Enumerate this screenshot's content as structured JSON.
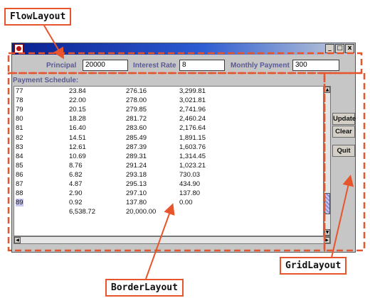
{
  "callouts": {
    "flow": "FlowLayout",
    "border": "BorderLayout",
    "grid": "GridLayout"
  },
  "window": {
    "controls": [
      "_",
      "□",
      "x"
    ]
  },
  "inputs": {
    "principal_label": "Principal",
    "principal_value": "20000",
    "rate_label": "Interest Rate",
    "rate_value": "8",
    "payment_label": "Monthly Payment",
    "payment_value": "300"
  },
  "schedule": {
    "label": "Payment Schedule:",
    "rows": [
      [
        "77",
        "23.84",
        "276.16",
        "3,299.81"
      ],
      [
        "78",
        "22.00",
        "278.00",
        "3,021.81"
      ],
      [
        "79",
        "20.15",
        "279.85",
        "2,741.96"
      ],
      [
        "80",
        "18.28",
        "281.72",
        "2,460.24"
      ],
      [
        "81",
        "16.40",
        "283.60",
        "2,176.64"
      ],
      [
        "82",
        "14.51",
        "285.49",
        "1,891.15"
      ],
      [
        "83",
        "12.61",
        "287.39",
        "1,603.76"
      ],
      [
        "84",
        "10.69",
        "289.31",
        "1,314.45"
      ],
      [
        "85",
        "8.76",
        "291.24",
        "1,023.21"
      ],
      [
        "86",
        "6.82",
        "293.18",
        "730.03"
      ],
      [
        "87",
        "4.87",
        "295.13",
        "434.90"
      ],
      [
        "88",
        "2.90",
        "297.10",
        "137.80"
      ],
      [
        "89",
        "0.92",
        "137.80",
        "0.00"
      ],
      [
        "",
        "6,538.72",
        "20,000.00",
        ""
      ]
    ]
  },
  "buttons": {
    "update": "Update",
    "clear": "Clear",
    "quit": "Quit"
  },
  "colors": {
    "annotation": "#e8542b",
    "label_text": "#5a5a96",
    "titlebar": "#0a1f8f"
  }
}
